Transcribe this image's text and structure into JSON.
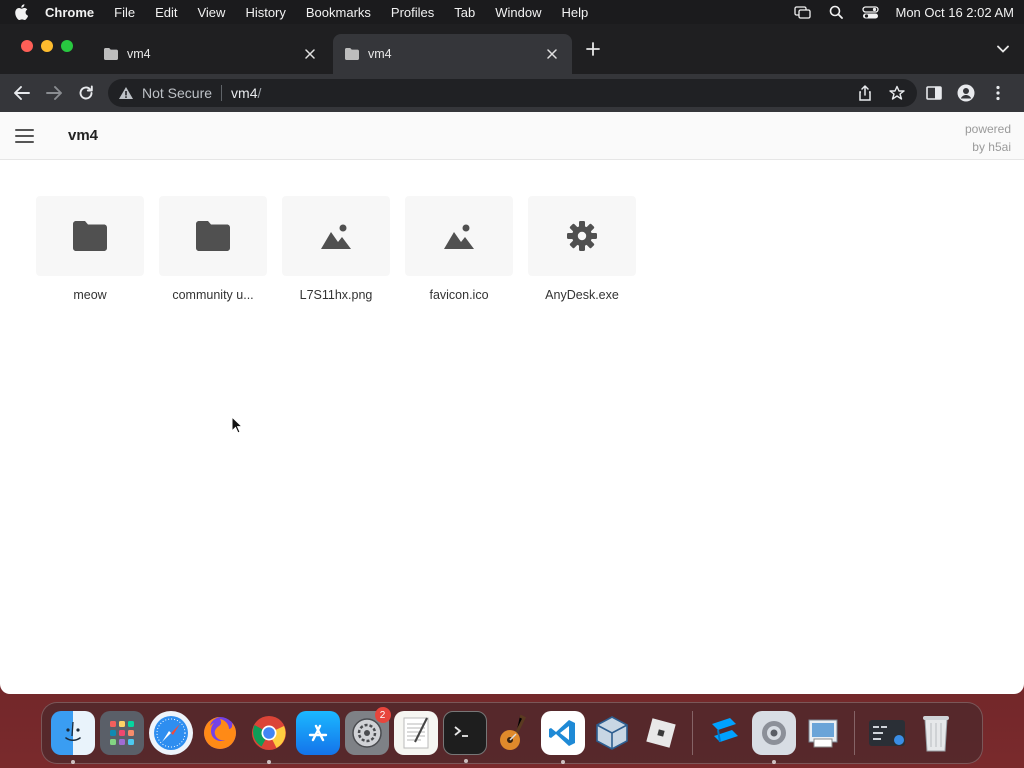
{
  "menubar": {
    "app_name": "Chrome",
    "items": [
      "File",
      "Edit",
      "View",
      "History",
      "Bookmarks",
      "Profiles",
      "Tab",
      "Window",
      "Help"
    ],
    "clock": "Mon Oct 16  2:02 AM",
    "status_icons": [
      "screen-mirroring-icon",
      "search-icon",
      "control-center-icon"
    ]
  },
  "browser": {
    "tabs": [
      {
        "title": "vm4",
        "active": false
      },
      {
        "title": "vm4",
        "active": true
      }
    ],
    "omnibox": {
      "security_label": "Not Secure",
      "url_host": "vm4",
      "url_path": "/"
    }
  },
  "page": {
    "title": "vm4",
    "powered_line1": "powered",
    "powered_line2": "by h5ai",
    "items": [
      {
        "name": "meow",
        "icon": "folder-icon"
      },
      {
        "name": "community u...",
        "icon": "folder-icon"
      },
      {
        "name": "L7S11hx.png",
        "icon": "image-icon"
      },
      {
        "name": "favicon.ico",
        "icon": "image-icon"
      },
      {
        "name": "AnyDesk.exe",
        "icon": "gear-icon"
      }
    ]
  },
  "dock": {
    "apps": [
      {
        "name": "finder",
        "running": true
      },
      {
        "name": "launchpad",
        "running": false
      },
      {
        "name": "safari",
        "running": false
      },
      {
        "name": "firefox",
        "running": false
      },
      {
        "name": "chrome",
        "running": true
      },
      {
        "name": "app-store",
        "running": false
      },
      {
        "name": "system-preferences",
        "running": false,
        "badge": "2"
      },
      {
        "name": "textedit",
        "running": false
      },
      {
        "name": "terminal",
        "running": true
      },
      {
        "name": "garageband",
        "running": false
      },
      {
        "name": "vscode",
        "running": true
      },
      {
        "name": "virtualbox",
        "running": false
      },
      {
        "name": "roblox",
        "running": false
      },
      {
        "name": "roblox-studio",
        "running": false
      },
      {
        "name": "settings-utility",
        "running": true
      },
      {
        "name": "preview",
        "running": false
      },
      {
        "name": "downloads-folder",
        "running": false
      },
      {
        "name": "trash",
        "running": false
      }
    ]
  },
  "colors": {
    "tab_active_bg": "#35363a",
    "tabstrip_bg": "#1f1f21",
    "page_bg": "#ffffff",
    "icon_gray": "#505050"
  }
}
